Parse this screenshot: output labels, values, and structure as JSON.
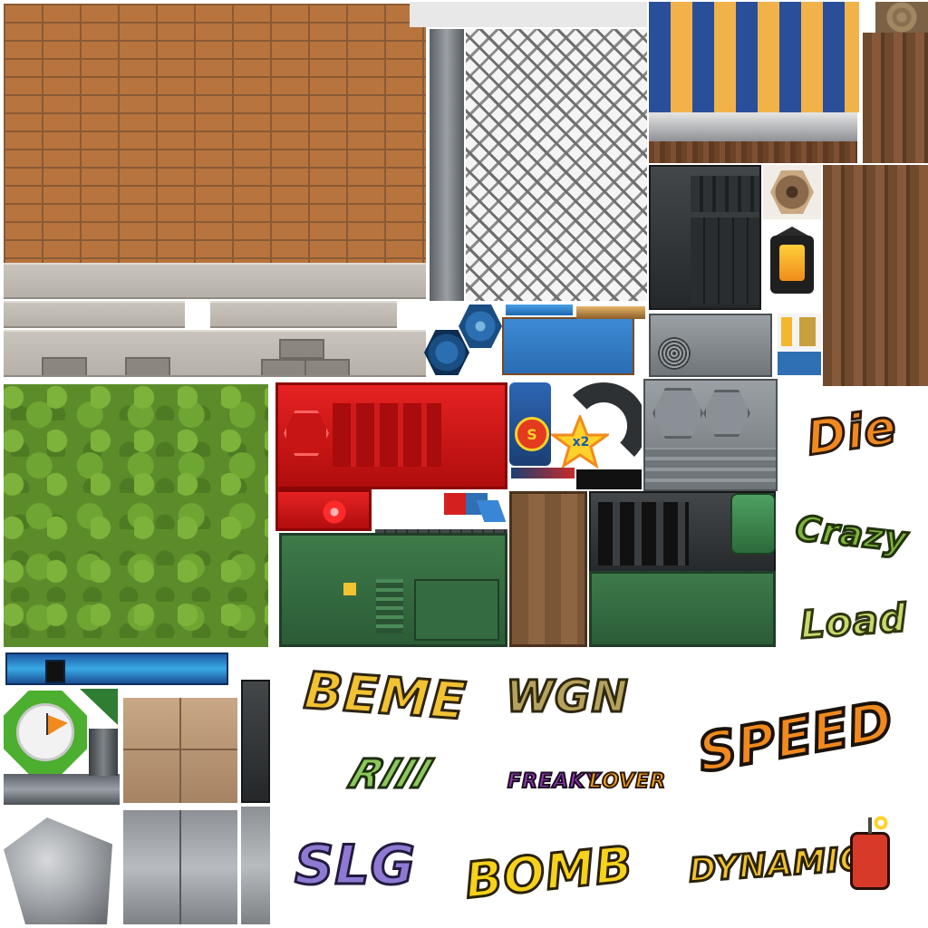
{
  "atlas": {
    "graffiti": {
      "die": "Die",
      "crazy": "Crazy",
      "load": "Load",
      "beme": "BEME",
      "wgn": "WGN",
      "riii": "RIII",
      "freaky": "FREAKY",
      "lover": "LOVER",
      "speed": "SPEED",
      "slg": "SLG",
      "bomb": "BOMB",
      "dynamic": "DYNAMIC"
    },
    "badges": {
      "s": "S",
      "x2": "x2"
    },
    "colors": {
      "brick": "#b8743e",
      "grass": "#5c8c2a",
      "awning_blue": "#2a4f9a",
      "awning_yellow": "#f2b24a",
      "red_panel": "#e52222",
      "green_panel": "#3e7a4a",
      "graffiti_orange": "#f08a1e",
      "graffiti_green": "#7fb33d",
      "graffiti_yellow": "#f1c232"
    }
  }
}
